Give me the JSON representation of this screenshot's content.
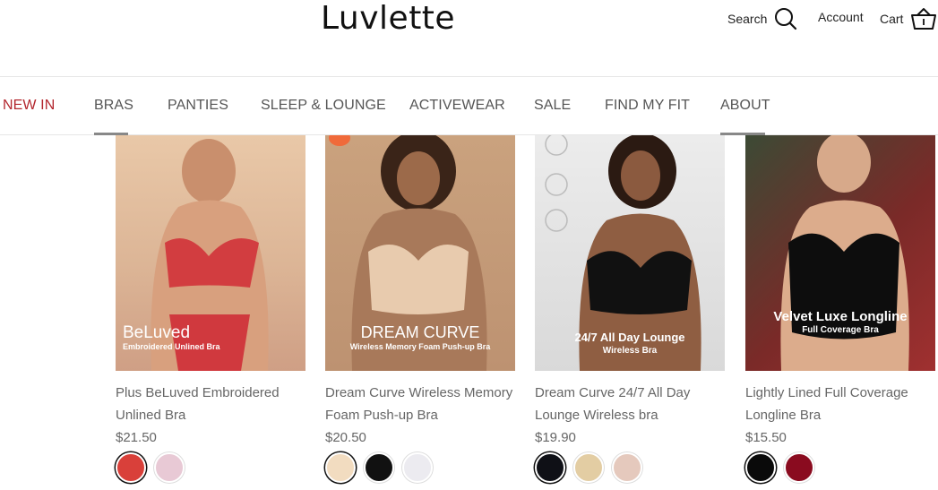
{
  "header": {
    "logo": "Luvlette",
    "search_label": "Search",
    "account_label": "Account",
    "cart_label": "Cart"
  },
  "nav": {
    "items": [
      "NEW IN",
      "BRAS",
      "PANTIES",
      "SLEEP & LOUNGE",
      "ACTIVEWEAR",
      "SALE",
      "FIND MY FIT",
      "ABOUT"
    ]
  },
  "colors": {
    "accent_red": "#b3262d",
    "text_gray": "#666666"
  },
  "products": [
    {
      "name": "Plus BeLuved Embroidered Unlined Bra",
      "price": "$21.50",
      "overlay_title": "BeLuved",
      "overlay_sub": "Embroidered Unlined Bra",
      "swatches": [
        "#d9403a",
        "#e8c9d5"
      ]
    },
    {
      "name": "Dream Curve Wireless Memory Foam Push-up Bra",
      "price": "$20.50",
      "overlay_title": "DREAM CURVE",
      "overlay_sub": "Wireless Memory Foam Push-up Bra",
      "swatches": [
        "#f2dcc0",
        "#111111",
        "#ecebf0"
      ]
    },
    {
      "name": "Dream Curve 24/7 All Day Lounge Wireless bra",
      "price": "$19.90",
      "overlay_title": "24/7 All Day Lounge",
      "overlay_sub": "Wireless Bra",
      "swatches": [
        "#0f1016",
        "#e3cda3",
        "#e5c9bd"
      ]
    },
    {
      "name": "Lightly Lined Full Coverage Longline Bra",
      "price": "$15.50",
      "overlay_title": "Velvet Luxe Longline",
      "overlay_sub": "Full Coverage Bra",
      "swatches": [
        "#0a0a0a",
        "#8a0b1f"
      ]
    }
  ]
}
